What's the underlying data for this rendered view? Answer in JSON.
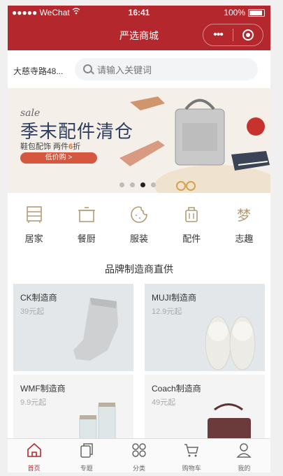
{
  "status_bar": {
    "carrier": "●●●●● WeChat",
    "wifi_icon": "wifi-icon",
    "time": "16:41",
    "battery": "100%"
  },
  "navbar": {
    "title": "严选商城",
    "more_icon": "•••",
    "close_icon": "target-icon"
  },
  "search": {
    "location": "大慈寺路48...",
    "placeholder": "请输入关键词"
  },
  "banner": {
    "sale": "sale",
    "title": "季末配件清仓",
    "sub_prefix": "鞋包配饰 两件",
    "sub_highlight": "6",
    "sub_suffix": "折",
    "button": "低价购 >",
    "dots": 4,
    "active_dot": 2
  },
  "categories": [
    {
      "label": "居家",
      "icon": "cabinet-icon"
    },
    {
      "label": "餐厨",
      "icon": "pot-icon"
    },
    {
      "label": "服装",
      "icon": "clothes-icon"
    },
    {
      "label": "配件",
      "icon": "luggage-icon"
    },
    {
      "label": "志趣",
      "icon": "interest-icon"
    }
  ],
  "section_title": "品牌制造商直供",
  "brands": [
    {
      "name": "CK制造商",
      "price": "39元起",
      "image": "socks"
    },
    {
      "name": "MUJI制造商",
      "price": "12.9元起",
      "image": "slippers"
    },
    {
      "name": "WMF制造商",
      "price": "9.9元起",
      "image": "jars"
    },
    {
      "name": "Coach制造商",
      "price": "49元起",
      "image": "handbag"
    }
  ],
  "tabs": [
    {
      "label": "首页",
      "icon": "home-icon",
      "active": true
    },
    {
      "label": "专题",
      "icon": "topic-icon",
      "active": false
    },
    {
      "label": "分类",
      "icon": "category-icon",
      "active": false
    },
    {
      "label": "购物车",
      "icon": "cart-icon",
      "active": false
    },
    {
      "label": "我的",
      "icon": "user-icon",
      "active": false
    }
  ],
  "colors": {
    "brand_red": "#b4282d",
    "accent": "#d5573d",
    "icon_tan": "#b39b77"
  }
}
